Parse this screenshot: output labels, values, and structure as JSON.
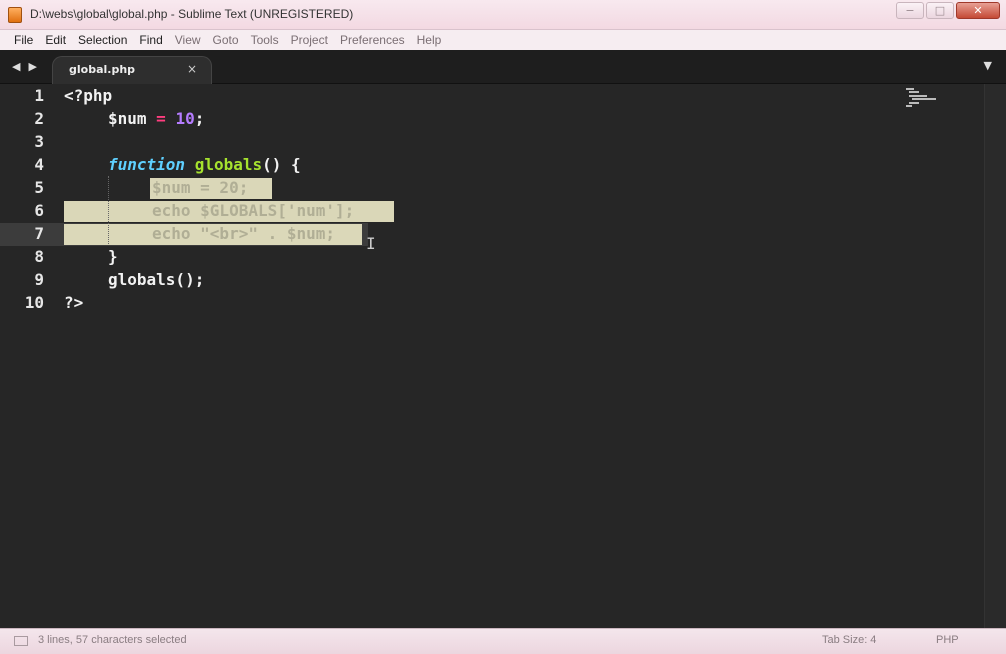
{
  "window": {
    "title": "D:\\webs\\global\\global.php - Sublime Text (UNREGISTERED)",
    "controls": {
      "minimize": "−",
      "maximize": "□",
      "close": "✕"
    }
  },
  "menu": [
    {
      "label": "File"
    },
    {
      "label": "Edit"
    },
    {
      "label": "Selection"
    },
    {
      "label": "Find"
    },
    {
      "label": "View"
    },
    {
      "label": "Goto"
    },
    {
      "label": "Tools"
    },
    {
      "label": "Project"
    },
    {
      "label": "Preferences"
    },
    {
      "label": "Help"
    }
  ],
  "tabs": [
    {
      "label": "global.php",
      "close": "×",
      "active": true
    }
  ],
  "nav": {
    "back": "◀",
    "forward": "▶",
    "tab_menu": "▼"
  },
  "editor": {
    "line_numbers": [
      "1",
      "2",
      "3",
      "4",
      "5",
      "6",
      "7",
      "8",
      "9",
      "10"
    ],
    "lines": {
      "l1": "<?php",
      "l2_var": "$num",
      "l2_op": " = ",
      "l2_num": "10",
      "l2_end": ";",
      "l4_kw": "function",
      "l4_name": "globals",
      "l4_end": "() {",
      "l5": "$num = 20;",
      "l6": "echo $GLOBALS['num'];",
      "l7": "echo \"<br>\" . $num;",
      "l8": "}",
      "l9": "globals();",
      "l10": "?>"
    },
    "active_line": 7,
    "selection": "lines 5-7"
  },
  "status": {
    "left": "3 lines, 57 characters selected",
    "tab_size": "Tab Size: 4",
    "syntax": "PHP"
  },
  "colors": {
    "background": "#262626",
    "keyword_pink": "#ff3d7f",
    "number_purple": "#b57cff",
    "storage_cyan": "#5fd0ff",
    "function_green": "#a6e22e",
    "selection": "#e9e6c4"
  }
}
